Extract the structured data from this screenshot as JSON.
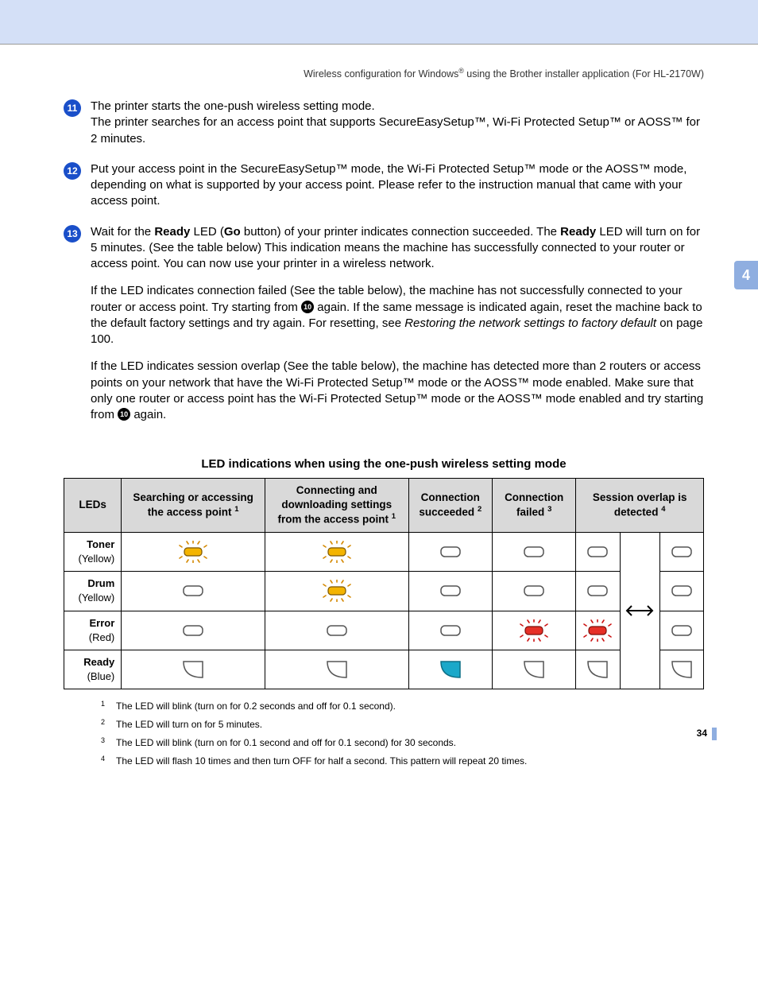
{
  "header": {
    "breadcrumb_pre": "Wireless configuration for Windows",
    "breadcrumb_sup": "®",
    "breadcrumb_post": " using the Brother installer application (For HL-2170W)"
  },
  "chapter_tab": "4",
  "page_number": "34",
  "steps": {
    "s11": {
      "num": "11",
      "p1": "The printer starts the one-push wireless setting mode.",
      "p2": "The printer searches for an access point that supports SecureEasySetup™, Wi-Fi Protected Setup™ or AOSS™ for 2 minutes."
    },
    "s12": {
      "num": "12",
      "p1": "Put your access point in the SecureEasySetup™ mode, the Wi-Fi Protected Setup™ mode or the AOSS™ mode, depending on what is supported by your access point. Please refer to the instruction manual that came with your access point."
    },
    "s13": {
      "num": "13",
      "p1a": "Wait for the ",
      "p1b": "Ready",
      "p1c": " LED (",
      "p1d": "Go",
      "p1e": " button) of your printer indicates connection succeeded. The ",
      "p1f": "Ready",
      "p1g": " LED will turn on for 5 minutes. (See the table below) This indication means the machine has successfully connected to your router or access point. You can now use your printer in a wireless network.",
      "p2a": "If the LED indicates connection failed (See the table below), the machine has not successfully connected to your router or access point. Try starting from ",
      "p2_badge": "10",
      "p2b": " again. If the same message is indicated again, reset the machine back to the default factory settings and try again. For resetting, see ",
      "p2c": "Restoring the network settings to factory default",
      "p2d": " on page 100.",
      "p3a": "If the LED indicates session overlap (See the table below), the machine has detected more than 2 routers or access points on your network that have the Wi-Fi Protected Setup™ mode or the AOSS™ mode enabled. Make sure that only one router or access point has the Wi-Fi Protected Setup™ mode or the AOSS™ mode enabled and try starting from ",
      "p3_badge": "10",
      "p3b": " again."
    }
  },
  "table": {
    "title": "LED indications when using the one-push wireless setting mode",
    "headers": {
      "leds": "LEDs",
      "col1": "Searching or accessing the access point",
      "col1_sup": "1",
      "col2": "Connecting and downloading settings from the access point",
      "col2_sup": "1",
      "col3": "Connection succeeded",
      "col3_sup": "2",
      "col4": "Connection failed",
      "col4_sup": "3",
      "col5": "Session overlap is detected",
      "col5_sup": "4"
    },
    "rows": {
      "toner": {
        "name": "Toner",
        "color": "(Yellow)"
      },
      "drum": {
        "name": "Drum",
        "color": "(Yellow)"
      },
      "error": {
        "name": "Error",
        "color": "(Red)"
      },
      "ready": {
        "name": "Ready",
        "color": "(Blue)"
      }
    }
  },
  "footnotes": {
    "f1": "The LED will blink (turn on for 0.2 seconds and off for 0.1 second).",
    "f2": "The LED will turn on for 5 minutes.",
    "f3": "The LED will blink (turn on for 0.1 second and off for 0.1 second) for 30 seconds.",
    "f4": "The LED will flash 10 times and then turn OFF for half a second. This pattern will repeat 20 times."
  },
  "chart_data": {
    "type": "table",
    "title": "LED indications when using the one-push wireless setting mode",
    "columns": [
      "LEDs",
      "Searching or accessing the access point",
      "Connecting and downloading settings from the access point",
      "Connection succeeded",
      "Connection failed",
      "Session overlap is detected (state A)",
      "Session overlap is detected (state B)"
    ],
    "rows": [
      {
        "led": "Toner (Yellow)",
        "values": [
          "blink-yellow",
          "blink-yellow",
          "off",
          "off",
          "off",
          "off"
        ]
      },
      {
        "led": "Drum (Yellow)",
        "values": [
          "off",
          "blink-yellow",
          "off",
          "off",
          "off",
          "off"
        ]
      },
      {
        "led": "Error (Red)",
        "values": [
          "off",
          "off",
          "off",
          "blink-red",
          "blink-red",
          "off"
        ]
      },
      {
        "led": "Ready (Blue)",
        "values": [
          "off-outline",
          "off-outline",
          "on-blue",
          "off-outline",
          "off-outline",
          "off-outline"
        ]
      }
    ],
    "note": "Session-overlap columns alternate (double-arrow between the two states)."
  }
}
